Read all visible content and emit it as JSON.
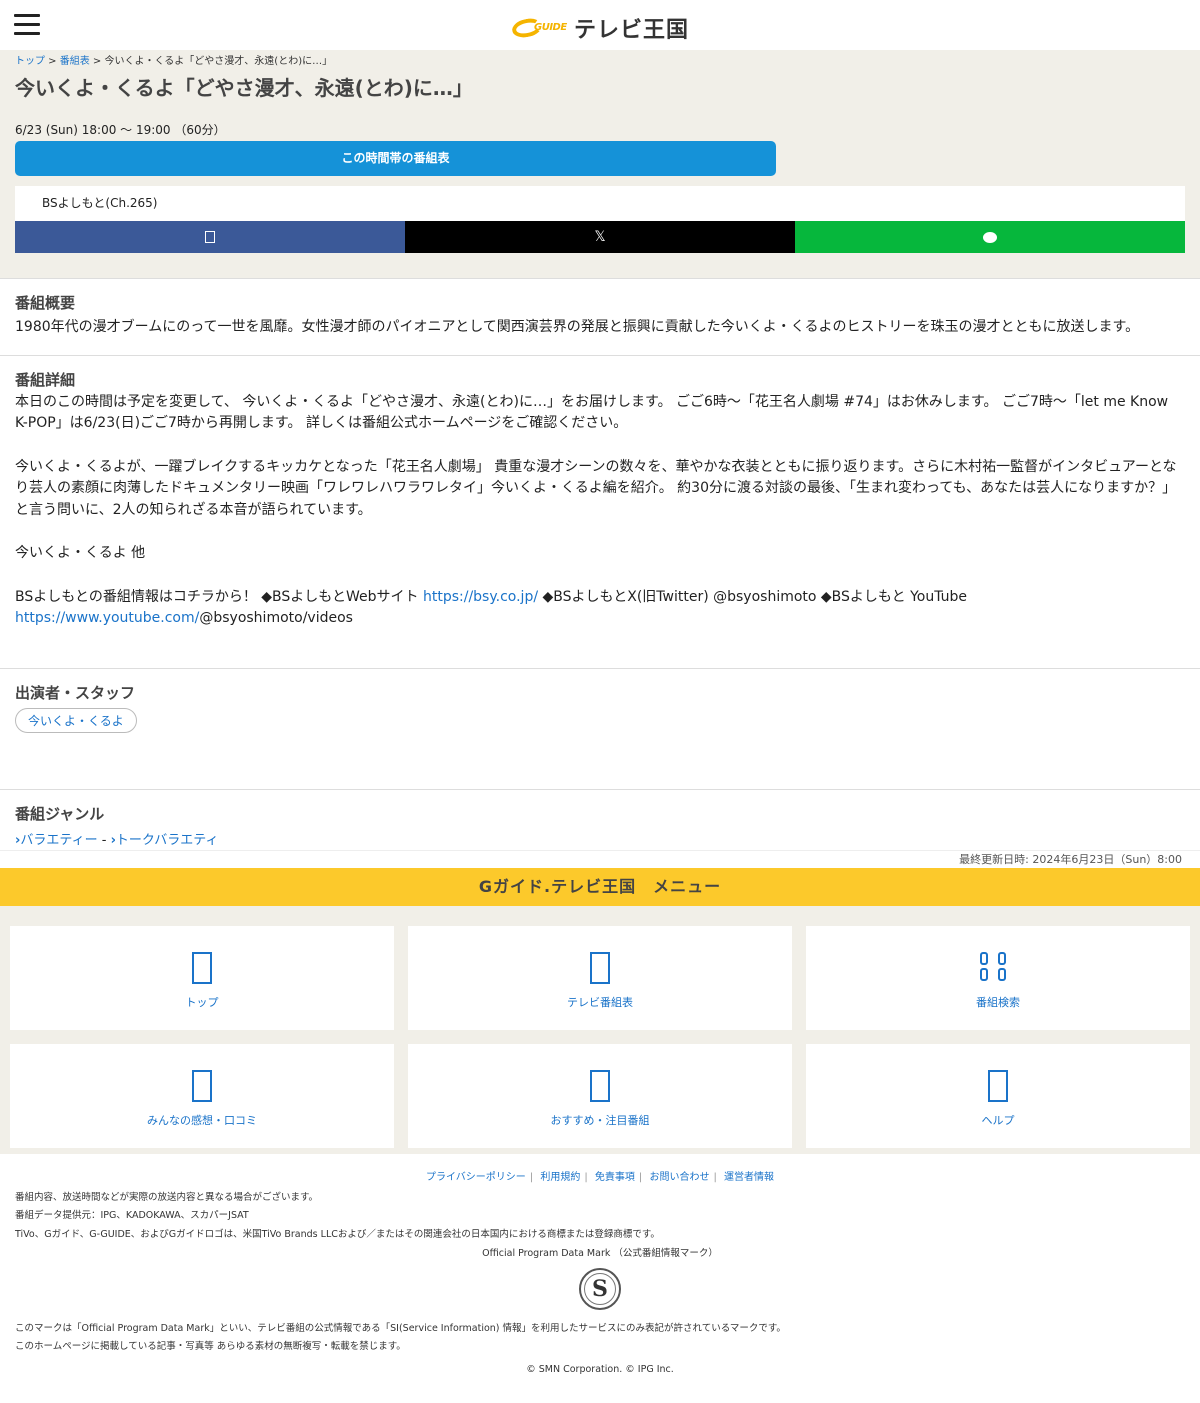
{
  "header": {
    "logo_mark": "GUIDE",
    "logo_text": "テレビ王国"
  },
  "breadcrumb": {
    "top": "トップ",
    "schedule": "番組表",
    "current": "今いくよ・くるよ「どやさ漫才、永遠(とわ)に…」"
  },
  "program": {
    "title": "今いくよ・くるよ「どやさ漫才、永遠(とわ)に…」",
    "time": "6/23 (Sun) 18:00 ～ 19:00 （60分）",
    "schedule_button": "この時間帯の番組表",
    "channel": "BSよしもと(Ch.265)"
  },
  "share": {
    "x_label": "𝕏"
  },
  "overview": {
    "heading": "番組概要",
    "text": "1980年代の漫才ブームにのって一世を風靡。女性漫才師のパイオニアとして関西演芸界の発展と振興に貢献した今いくよ・くるよのヒストリーを珠玉の漫才とともに放送します。"
  },
  "detail": {
    "heading": "番組詳細",
    "p1": "本日のこの時間は予定を変更して、 今いくよ・くるよ「どやさ漫才、永遠(とわ)に…」をお届けします。 ごご6時～「花王名人劇場 #74」はお休みします。 ごご7時～「let me Know K-POP」は6/23(日)ごご7時から再開します。 詳しくは番組公式ホームページをご確認ください。",
    "p2": "今いくよ・くるよが、一躍ブレイクするキッカケとなった「花王名人劇場」 貴重な漫才シーンの数々を、華やかな衣装とともに振り返ります。さらに木村祐一監督がインタビュアーとなり芸人の素顔に肉薄したドキュメンタリー映画「ワレワレハワラワレタイ」今いくよ・くるよ編を紹介。 約30分に渡る対談の最後、「生まれ変わっても、あなたは芸人になりますか？」と言う問いに、2人の知られざる本音が語られています。",
    "p3": "今いくよ・くるよ 他",
    "p4_a": "BSよしもとの番組情報はコチラから！ ◆BSよしもとWebサイト ",
    "p4_link1": "https://bsy.co.jp/",
    "p4_b": " ◆BSよしもとX(旧Twitter) @bsyoshimoto ◆BSよしもと YouTube ",
    "p4_link2": "https://www.youtube.com/",
    "p4_c": "@bsyoshimoto/videos"
  },
  "cast": {
    "heading": "出演者・スタッフ",
    "tag": "今いくよ・くるよ"
  },
  "genre": {
    "heading": "番組ジャンル",
    "main": "バラエティー",
    "sep": " - ",
    "sub": "トークバラエティ"
  },
  "updated": "最終更新日時: 2024年6月23日（Sun）8:00",
  "menu": {
    "title": "Gガイド.テレビ王国　メニュー",
    "items": [
      {
        "label": "トップ"
      },
      {
        "label": "テレビ番組表"
      },
      {
        "label": "番組検索"
      },
      {
        "label": "みんなの感想・口コミ"
      },
      {
        "label": "おすすめ・注目番組"
      },
      {
        "label": "ヘルプ"
      }
    ]
  },
  "footer": {
    "links": [
      "プライバシーポリシー",
      "利用規約",
      "免責事項",
      "お問い合わせ",
      "運営者情報"
    ],
    "note1": "番組内容、放送時間などが実際の放送内容と異なる場合がございます。",
    "note2": "番組データ提供元：IPG、KADOKAWA、スカパーJSAT",
    "note3": "TiVo、Gガイド、G-GUIDE、およびGガイドロゴは、米国TiVo Brands LLCおよび／またはその関連会社の日本国内における商標または登録商標です。",
    "opdm": "Official Program Data Mark （公式番組情報マーク）",
    "seal_letter": "S",
    "note4": "このマークは「Official Program Data Mark」といい、テレビ番組の公式情報である「SI(Service Information) 情報」を利用したサービスにのみ表記が許されているマークです。",
    "note5": "このホームページに掲載している記事・写真等 あらゆる素材の無断複写・転載を禁じます。",
    "copyright": "© SMN Corporation. © IPG Inc."
  },
  "colors": {
    "accent_blue": "#1592d8",
    "menu_yellow": "#fcc92b",
    "facebook": "#3b5998",
    "line": "#06b73c"
  }
}
